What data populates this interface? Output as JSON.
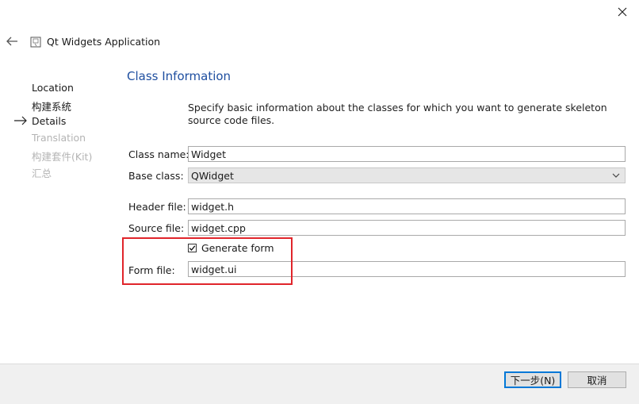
{
  "header": {
    "app_title": "Qt Widgets Application"
  },
  "steps": [
    {
      "label": "Location",
      "state": "done"
    },
    {
      "label": "构建系统",
      "state": "done"
    },
    {
      "label": "Details",
      "state": "current"
    },
    {
      "label": "Translation",
      "state": "disabled"
    },
    {
      "label": "构建套件(Kit)",
      "state": "disabled"
    },
    {
      "label": "汇总",
      "state": "disabled"
    }
  ],
  "content": {
    "title": "Class Information",
    "description": "Specify basic information about the classes for which you want to generate skeleton source code files.",
    "class_name_label": "Class name:",
    "class_name_value": "Widget",
    "base_class_label": "Base class:",
    "base_class_value": "QWidget",
    "header_file_label": "Header file:",
    "header_file_value": "widget.h",
    "source_file_label": "Source file:",
    "source_file_value": "widget.cpp",
    "generate_form_label": "Generate form",
    "generate_form_checked": true,
    "form_file_label": "Form file:",
    "form_file_value": "widget.ui"
  },
  "footer": {
    "next_label": "下一步(N)",
    "cancel_label": "取消"
  },
  "colors": {
    "title_blue": "#1f4fa0",
    "highlight_red": "#e0252b",
    "disabled_text": "#b4b4b4",
    "default_button_border": "#0078d7"
  },
  "icons": [
    "close-icon",
    "back-arrow-icon",
    "app-icon",
    "current-step-arrow-icon",
    "chevron-down-icon",
    "checkmark-icon"
  ]
}
